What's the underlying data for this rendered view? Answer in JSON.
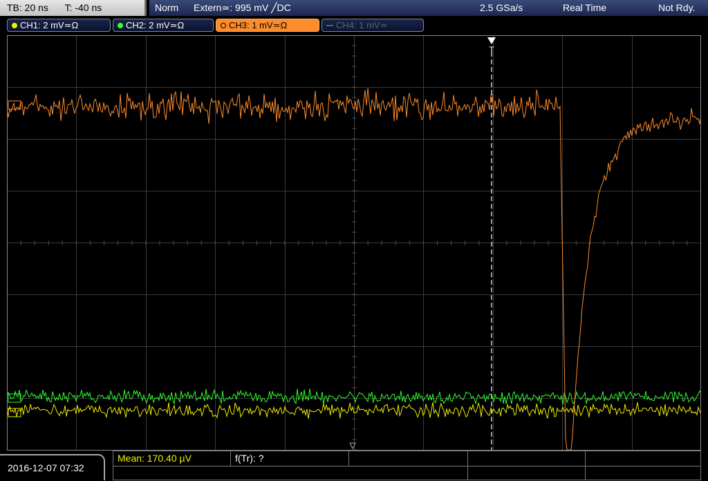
{
  "header": {
    "timebase": "TB: 20 ns",
    "trigger_time": "T: -40 ns",
    "trigger_mode": "Norm",
    "trigger_source": "Extern≃: 995 mV ╱DC",
    "sample_rate": "2.5 GSa/s",
    "acq_mode": "Real Time",
    "status": "Not Rdy."
  },
  "channels": [
    {
      "label": "CH1: 2 mV≃Ω",
      "color": "#f0f000",
      "active": false
    },
    {
      "label": "CH2: 2 mV≃Ω",
      "color": "#30ff30",
      "active": false
    },
    {
      "label": "CH3: 1 mV≃Ω",
      "color": "#ff8c2a",
      "active": true
    },
    {
      "label": "CH4: 1 mV≃",
      "color": "#5a6378",
      "active": false
    }
  ],
  "trigger_marker": "T",
  "footer": {
    "datetime": "2016-12-07 07:32",
    "mean_label": "Mean: 170.40 µV",
    "ftr_label": "f(Tr): ?"
  },
  "colors": {
    "ch1": "#f0f000",
    "ch2": "#30ff30",
    "ch3": "#ff8c2a",
    "grid": "#3a3a3a",
    "mean_text": "#f0f000"
  }
}
